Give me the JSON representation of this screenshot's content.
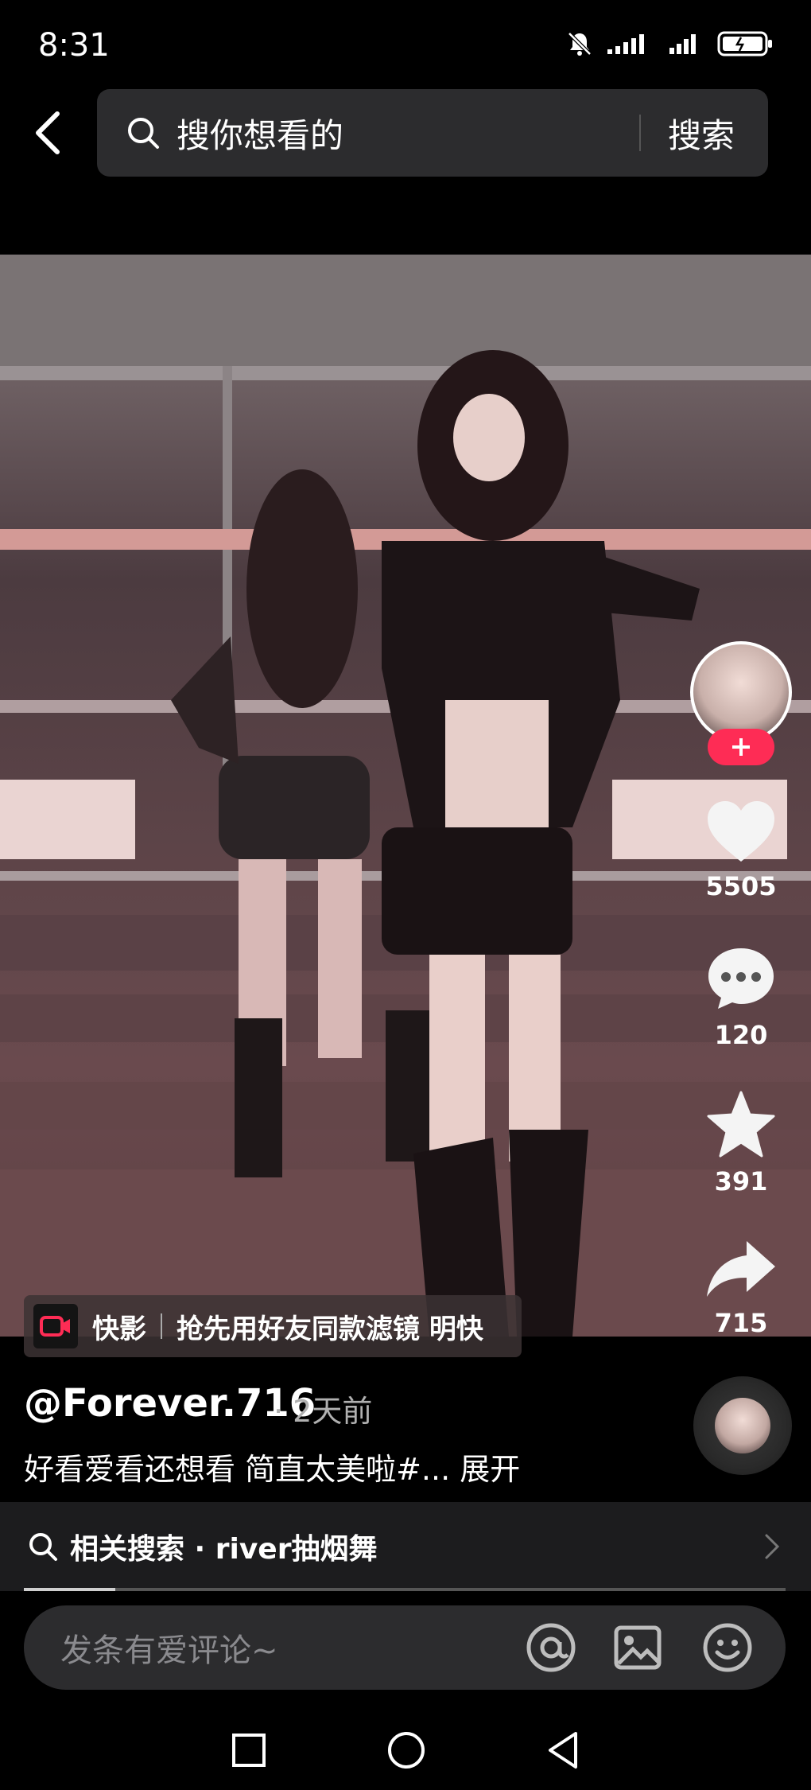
{
  "status_bar": {
    "time": "8:31",
    "icons": [
      "mute-icon",
      "signal-icon",
      "signal-icon",
      "battery-icon"
    ]
  },
  "header": {
    "back_icon": "back-arrow-icon",
    "search_placeholder": "搜你想看的",
    "search_button": "搜索"
  },
  "actions": {
    "like_count": "5505",
    "comment_count": "120",
    "favorite_count": "391",
    "share_count": "715"
  },
  "banner": {
    "app_name": "快影",
    "text": "抢先用好友同款滤镜 明快"
  },
  "post": {
    "author": "@Forever.716",
    "time_ago": "· 2天前",
    "caption": "好看爱看还想看 简直太美啦#... 展开"
  },
  "related_search": {
    "label": "相关搜索 · river抽烟舞"
  },
  "progress": {
    "value_fraction": 0.12
  },
  "comment": {
    "placeholder": "发条有爱评论~"
  },
  "colors": {
    "accent": "#fe2c55",
    "background": "#000000",
    "panel": "#2c2c2e"
  }
}
